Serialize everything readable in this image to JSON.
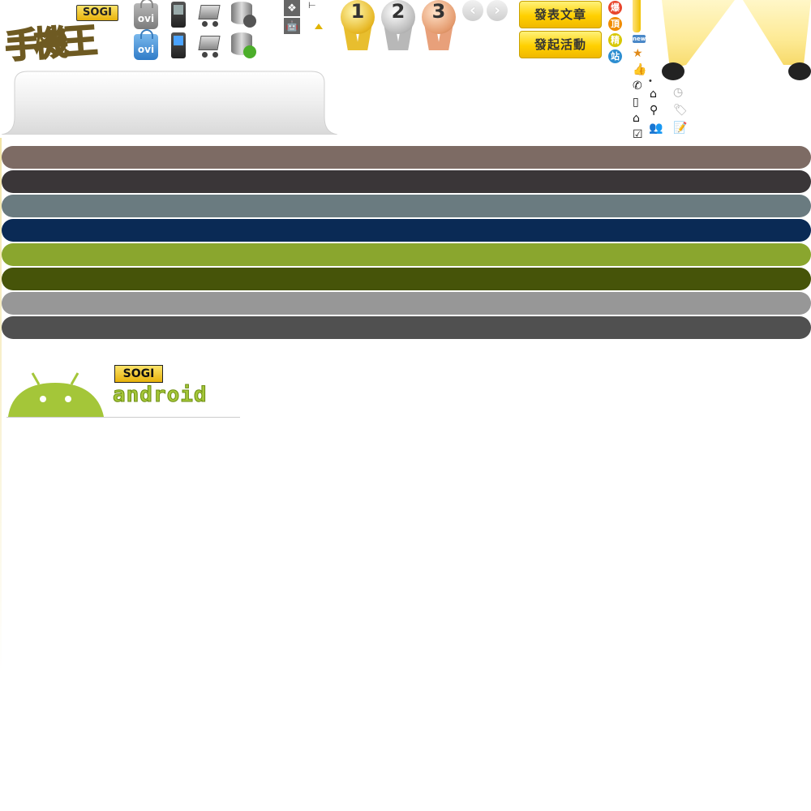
{
  "logo": {
    "badge": "SOGI",
    "name": "手機王"
  },
  "icons": {
    "ovi_label": "ovi",
    "row1": [
      "ovi-store-grey-icon",
      "phone-grey-icon",
      "cart-grey-icon",
      "database-download-icon"
    ],
    "row2": [
      "ovi-store-blue-icon",
      "phone-blue-icon",
      "cart-blue-icon",
      "database-add-icon"
    ],
    "windows_glyph": "❖",
    "android_glyph": "🤖",
    "tree_glyph": "⊢"
  },
  "medals": [
    "1",
    "2",
    "3"
  ],
  "nav_arrows": {
    "prev": "‹",
    "next": "›"
  },
  "buttons": {
    "post_article": "發表文章",
    "start_event": "發起活動"
  },
  "badges": [
    {
      "label": "爆",
      "color": "#e8452c"
    },
    {
      "label": "頂",
      "color": "#f08c00"
    },
    {
      "label": "精",
      "color": "#d7c700"
    },
    {
      "label": "站",
      "color": "#2d8ed1"
    }
  ],
  "small_icons": {
    "new_label": "new",
    "dot": "•"
  },
  "android_banner": {
    "badge": "SOGI",
    "word": "android"
  },
  "stripes": [
    "#7d6b64",
    "#3a3638",
    "#6a7b80",
    "#0a2a55",
    "#8aa62e",
    "#465409",
    "#979797",
    "#505050"
  ]
}
